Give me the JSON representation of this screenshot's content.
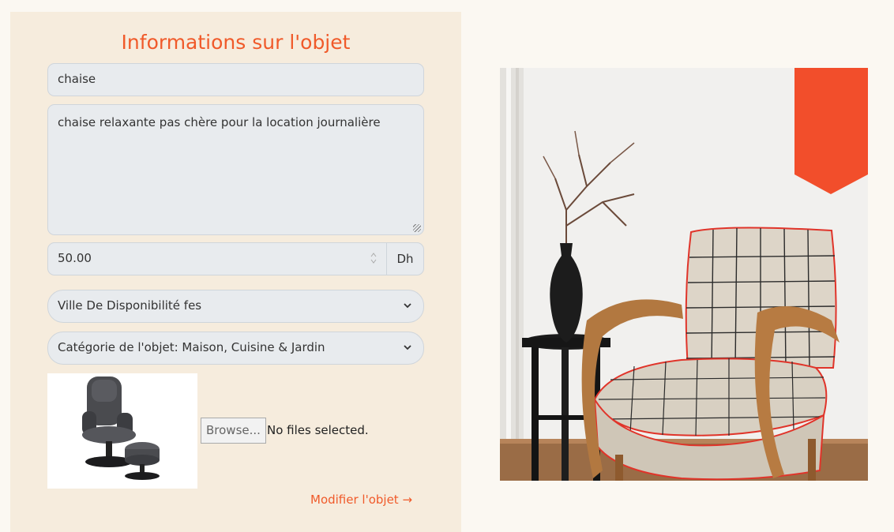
{
  "form": {
    "title": "Informations sur l'objet",
    "name_value": "chaise",
    "description_value": "chaise relaxante pas chère pour la location journalière",
    "price_value": "50.00",
    "price_unit": "Dh",
    "city_select": "Ville De Disponibilité fes",
    "category_select": "Catégorie de l'objet: Maison, Cuisine & Jardin",
    "browse_label": "Browse...",
    "file_status": "No files selected.",
    "submit_link": "Modifier l'objet →"
  },
  "icons": {
    "spinner": "spinner-arrows-icon",
    "chevron": "chevron-down-icon",
    "resize": "resize-grip-icon"
  },
  "colors": {
    "accent": "#f05a2a",
    "panel_bg": "#f6ecdd",
    "page_bg": "#fbf8f2",
    "input_bg": "#e8ebee"
  }
}
